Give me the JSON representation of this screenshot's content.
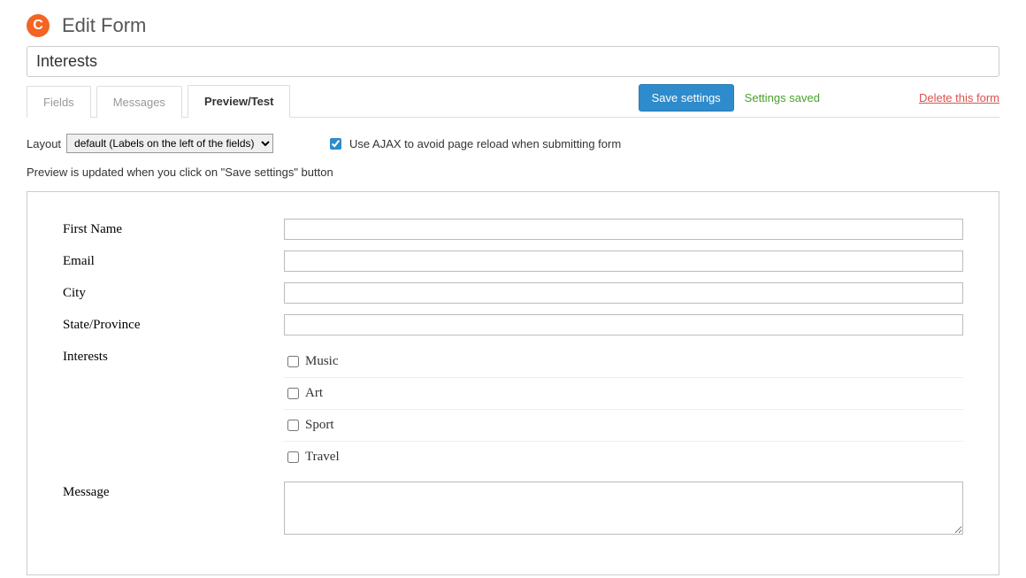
{
  "header": {
    "logo_letter": "C",
    "title": "Edit Form"
  },
  "form_name": "Interests",
  "tabs": [
    {
      "label": "Fields",
      "active": false
    },
    {
      "label": "Messages",
      "active": false
    },
    {
      "label": "Preview/Test",
      "active": true
    }
  ],
  "actions": {
    "save_label": "Save settings",
    "status_text": "Settings saved",
    "delete_label": "Delete this form"
  },
  "options": {
    "layout_label": "Layout",
    "layout_value": "default (Labels on the left of the fields)",
    "ajax_checked": true,
    "ajax_label": "Use AJAX to avoid page reload when submitting form"
  },
  "note": "Preview is updated when you click on \"Save settings\" button",
  "preview": {
    "fields": [
      {
        "label": "First Name",
        "type": "text"
      },
      {
        "label": "Email",
        "type": "text"
      },
      {
        "label": "City",
        "type": "text"
      },
      {
        "label": "State/Province",
        "type": "text"
      },
      {
        "label": "Interests",
        "type": "checkboxes",
        "options": [
          "Music",
          "Art",
          "Sport",
          "Travel"
        ]
      },
      {
        "label": "Message",
        "type": "textarea"
      }
    ]
  }
}
